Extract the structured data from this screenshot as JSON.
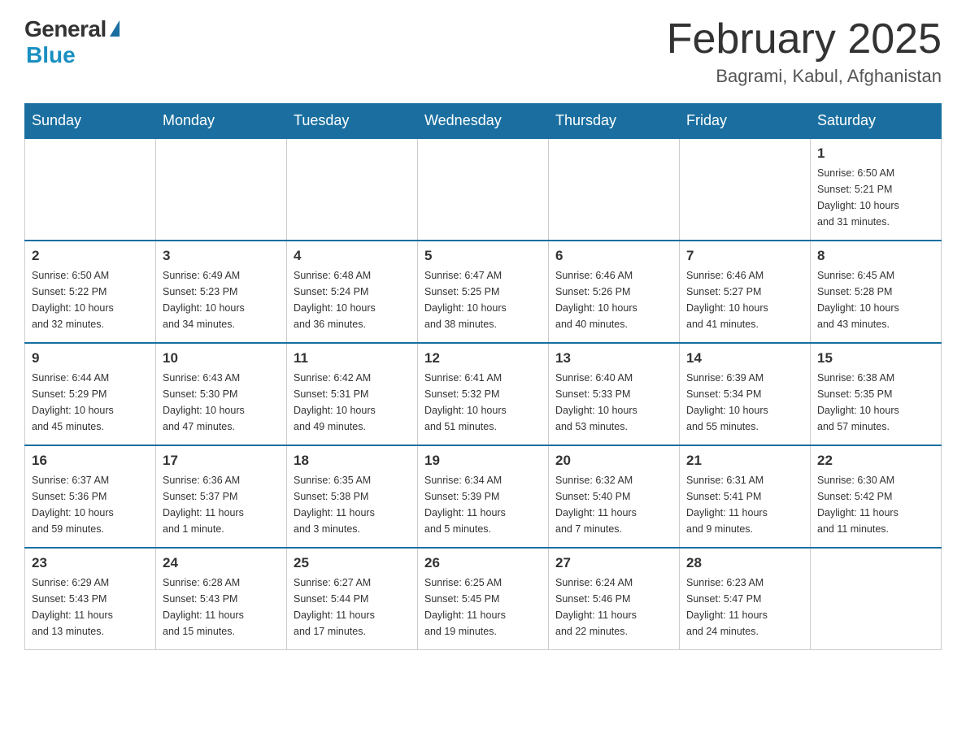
{
  "logo": {
    "general": "General",
    "blue": "Blue"
  },
  "title": "February 2025",
  "location": "Bagrami, Kabul, Afghanistan",
  "days_of_week": [
    "Sunday",
    "Monday",
    "Tuesday",
    "Wednesday",
    "Thursday",
    "Friday",
    "Saturday"
  ],
  "weeks": [
    [
      {
        "day": "",
        "info": ""
      },
      {
        "day": "",
        "info": ""
      },
      {
        "day": "",
        "info": ""
      },
      {
        "day": "",
        "info": ""
      },
      {
        "day": "",
        "info": ""
      },
      {
        "day": "",
        "info": ""
      },
      {
        "day": "1",
        "info": "Sunrise: 6:50 AM\nSunset: 5:21 PM\nDaylight: 10 hours\nand 31 minutes."
      }
    ],
    [
      {
        "day": "2",
        "info": "Sunrise: 6:50 AM\nSunset: 5:22 PM\nDaylight: 10 hours\nand 32 minutes."
      },
      {
        "day": "3",
        "info": "Sunrise: 6:49 AM\nSunset: 5:23 PM\nDaylight: 10 hours\nand 34 minutes."
      },
      {
        "day": "4",
        "info": "Sunrise: 6:48 AM\nSunset: 5:24 PM\nDaylight: 10 hours\nand 36 minutes."
      },
      {
        "day": "5",
        "info": "Sunrise: 6:47 AM\nSunset: 5:25 PM\nDaylight: 10 hours\nand 38 minutes."
      },
      {
        "day": "6",
        "info": "Sunrise: 6:46 AM\nSunset: 5:26 PM\nDaylight: 10 hours\nand 40 minutes."
      },
      {
        "day": "7",
        "info": "Sunrise: 6:46 AM\nSunset: 5:27 PM\nDaylight: 10 hours\nand 41 minutes."
      },
      {
        "day": "8",
        "info": "Sunrise: 6:45 AM\nSunset: 5:28 PM\nDaylight: 10 hours\nand 43 minutes."
      }
    ],
    [
      {
        "day": "9",
        "info": "Sunrise: 6:44 AM\nSunset: 5:29 PM\nDaylight: 10 hours\nand 45 minutes."
      },
      {
        "day": "10",
        "info": "Sunrise: 6:43 AM\nSunset: 5:30 PM\nDaylight: 10 hours\nand 47 minutes."
      },
      {
        "day": "11",
        "info": "Sunrise: 6:42 AM\nSunset: 5:31 PM\nDaylight: 10 hours\nand 49 minutes."
      },
      {
        "day": "12",
        "info": "Sunrise: 6:41 AM\nSunset: 5:32 PM\nDaylight: 10 hours\nand 51 minutes."
      },
      {
        "day": "13",
        "info": "Sunrise: 6:40 AM\nSunset: 5:33 PM\nDaylight: 10 hours\nand 53 minutes."
      },
      {
        "day": "14",
        "info": "Sunrise: 6:39 AM\nSunset: 5:34 PM\nDaylight: 10 hours\nand 55 minutes."
      },
      {
        "day": "15",
        "info": "Sunrise: 6:38 AM\nSunset: 5:35 PM\nDaylight: 10 hours\nand 57 minutes."
      }
    ],
    [
      {
        "day": "16",
        "info": "Sunrise: 6:37 AM\nSunset: 5:36 PM\nDaylight: 10 hours\nand 59 minutes."
      },
      {
        "day": "17",
        "info": "Sunrise: 6:36 AM\nSunset: 5:37 PM\nDaylight: 11 hours\nand 1 minute."
      },
      {
        "day": "18",
        "info": "Sunrise: 6:35 AM\nSunset: 5:38 PM\nDaylight: 11 hours\nand 3 minutes."
      },
      {
        "day": "19",
        "info": "Sunrise: 6:34 AM\nSunset: 5:39 PM\nDaylight: 11 hours\nand 5 minutes."
      },
      {
        "day": "20",
        "info": "Sunrise: 6:32 AM\nSunset: 5:40 PM\nDaylight: 11 hours\nand 7 minutes."
      },
      {
        "day": "21",
        "info": "Sunrise: 6:31 AM\nSunset: 5:41 PM\nDaylight: 11 hours\nand 9 minutes."
      },
      {
        "day": "22",
        "info": "Sunrise: 6:30 AM\nSunset: 5:42 PM\nDaylight: 11 hours\nand 11 minutes."
      }
    ],
    [
      {
        "day": "23",
        "info": "Sunrise: 6:29 AM\nSunset: 5:43 PM\nDaylight: 11 hours\nand 13 minutes."
      },
      {
        "day": "24",
        "info": "Sunrise: 6:28 AM\nSunset: 5:43 PM\nDaylight: 11 hours\nand 15 minutes."
      },
      {
        "day": "25",
        "info": "Sunrise: 6:27 AM\nSunset: 5:44 PM\nDaylight: 11 hours\nand 17 minutes."
      },
      {
        "day": "26",
        "info": "Sunrise: 6:25 AM\nSunset: 5:45 PM\nDaylight: 11 hours\nand 19 minutes."
      },
      {
        "day": "27",
        "info": "Sunrise: 6:24 AM\nSunset: 5:46 PM\nDaylight: 11 hours\nand 22 minutes."
      },
      {
        "day": "28",
        "info": "Sunrise: 6:23 AM\nSunset: 5:47 PM\nDaylight: 11 hours\nand 24 minutes."
      },
      {
        "day": "",
        "info": ""
      }
    ]
  ]
}
